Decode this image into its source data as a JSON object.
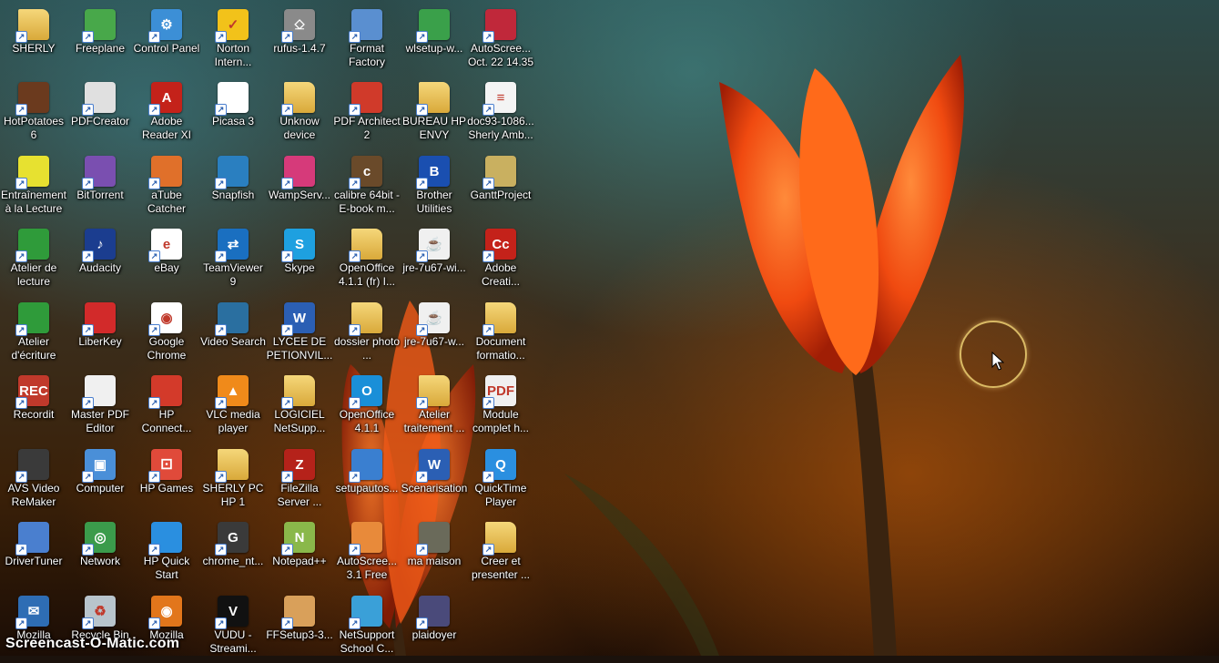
{
  "desktop": {
    "icons": [
      {
        "label": "SHERLY",
        "icon": "folder-icon",
        "color": "#e8c25a"
      },
      {
        "label": "HotPotatoes 6",
        "icon": "hotpotatoes-icon",
        "color": "#6b3a1e"
      },
      {
        "label": "Entraînement à la Lecture",
        "icon": "lecture-icon",
        "color": "#e7e130"
      },
      {
        "label": "Atelier de lecture",
        "icon": "atelier-icon",
        "color": "#2f9b3a"
      },
      {
        "label": "Atelier d'écriture",
        "icon": "atelier-ecriture-icon",
        "color": "#2f9b3a"
      },
      {
        "label": "Recordit",
        "icon": "record-icon",
        "color": "#c0392b"
      },
      {
        "label": "AVS Video ReMaker",
        "icon": "film-icon",
        "color": "#3a3a3a"
      },
      {
        "label": "DriverTuner",
        "icon": "driver-icon",
        "color": "#4a7fcf"
      },
      {
        "label": "Mozilla",
        "icon": "thunderbird-icon",
        "color": "#2e6db4"
      },
      {
        "label": "Freeplane",
        "icon": "freeplane-icon",
        "color": "#48a84a"
      },
      {
        "label": "PDFCreator",
        "icon": "pdf-creator-icon",
        "color": "#e0e0e0"
      },
      {
        "label": "BitTorrent",
        "icon": "bittorrent-icon",
        "color": "#7a4fb0"
      },
      {
        "label": "Audacity",
        "icon": "audacity-icon",
        "color": "#1b3d8f"
      },
      {
        "label": "LiberKey",
        "icon": "liberkey-icon",
        "color": "#d22a2a"
      },
      {
        "label": "Master PDF Editor",
        "icon": "pdf-editor-icon",
        "color": "#f0f0f0"
      },
      {
        "label": "Computer",
        "icon": "computer-icon",
        "color": "#4a8fd8"
      },
      {
        "label": "Network",
        "icon": "network-icon",
        "color": "#3b9b4b"
      },
      {
        "label": "Recycle Bin",
        "icon": "recycle-bin-icon",
        "color": "#b8c4cc"
      },
      {
        "label": "Control Panel",
        "icon": "control-panel-icon",
        "color": "#3c8fd6"
      },
      {
        "label": "Adobe Reader XI",
        "icon": "adobe-reader-icon",
        "color": "#c4221a"
      },
      {
        "label": "aTube Catcher",
        "icon": "atube-icon",
        "color": "#e0702a"
      },
      {
        "label": "eBay",
        "icon": "ebay-icon",
        "color": "#ffffff"
      },
      {
        "label": "Google Chrome",
        "icon": "chrome-icon",
        "color": "#ffffff"
      },
      {
        "label": "HP Connect...",
        "icon": "hp-connect-icon",
        "color": "#d33a2a"
      },
      {
        "label": "HP Games",
        "icon": "hp-games-icon",
        "color": "#e04a3a"
      },
      {
        "label": "HP Quick Start",
        "icon": "hp-quickstart-icon",
        "color": "#2a8fe0"
      },
      {
        "label": "Mozilla",
        "icon": "firefox-icon",
        "color": "#e2761b"
      },
      {
        "label": "Norton Intern...",
        "icon": "norton-icon",
        "color": "#f2c21a"
      },
      {
        "label": "Picasa 3",
        "icon": "picasa-icon",
        "color": "#ffffff"
      },
      {
        "label": "Snapfish",
        "icon": "snapfish-icon",
        "color": "#2a7fc0"
      },
      {
        "label": "TeamViewer 9",
        "icon": "teamviewer-icon",
        "color": "#1a6fc0"
      },
      {
        "label": "Video Search",
        "icon": "video-search-icon",
        "color": "#2a6fa0"
      },
      {
        "label": "VLC media player",
        "icon": "vlc-icon",
        "color": "#f08a1a"
      },
      {
        "label": "SHERLY PC HP 1",
        "icon": "folder-icon",
        "color": "#e8c25a"
      },
      {
        "label": "chrome_nt...",
        "icon": "google-icon",
        "color": "#3a3a3a"
      },
      {
        "label": "VUDU - Streami...",
        "icon": "vudu-icon",
        "color": "#111111"
      },
      {
        "label": "rufus-1.4.7",
        "icon": "usb-icon",
        "color": "#8a8a8a"
      },
      {
        "label": "Unknow device",
        "icon": "folder-icon",
        "color": "#e8c25a"
      },
      {
        "label": "WampServ...",
        "icon": "wamp-icon",
        "color": "#d63a7a"
      },
      {
        "label": "Skype",
        "icon": "skype-icon",
        "color": "#1ea0e0"
      },
      {
        "label": "LYCEE DE PETIONVIL...",
        "icon": "word-icon",
        "color": "#2b5fb4"
      },
      {
        "label": "LOGICIEL NetSupp...",
        "icon": "folder-icon",
        "color": "#e8c25a"
      },
      {
        "label": "FileZilla Server ...",
        "icon": "filezilla-icon",
        "color": "#b5221a"
      },
      {
        "label": "Notepad++",
        "icon": "notepad-icon",
        "color": "#8ab84a"
      },
      {
        "label": "FFSetup3-3...",
        "icon": "setup-icon",
        "color": "#d9a05a"
      },
      {
        "label": "Format Factory",
        "icon": "format-factory-icon",
        "color": "#5a8fd0"
      },
      {
        "label": "PDF Architect 2",
        "icon": "pdf-architect-icon",
        "color": "#d03a2a"
      },
      {
        "label": "calibre 64bit - E-book m...",
        "icon": "calibre-icon",
        "color": "#6a4a2a"
      },
      {
        "label": "OpenOffice 4.1.1 (fr) I...",
        "icon": "folder-icon",
        "color": "#e8c25a"
      },
      {
        "label": "dossier photo ...",
        "icon": "folder-icon",
        "color": "#e8c25a"
      },
      {
        "label": "OpenOffice 4.1.1",
        "icon": "openoffice-icon",
        "color": "#1a8fd8"
      },
      {
        "label": "setupautos...",
        "icon": "installer-icon",
        "color": "#3a7fd0"
      },
      {
        "label": "AutoScree... 3.1 Free",
        "icon": "autoscreen-icon",
        "color": "#e88a3a"
      },
      {
        "label": "NetSupport School C...",
        "icon": "netsupport-icon",
        "color": "#3aa0d8"
      },
      {
        "label": "wlsetup-w...",
        "icon": "wlsetup-icon",
        "color": "#3aa04a"
      },
      {
        "label": "BUREAU HP ENVY",
        "icon": "folder-icon",
        "color": "#e8c25a"
      },
      {
        "label": "Brother Utilities",
        "icon": "brother-icon",
        "color": "#1a4fb0"
      },
      {
        "label": "jre-7u67-wi...",
        "icon": "java-icon",
        "color": "#f0f0f0"
      },
      {
        "label": "jre-7u67-w...",
        "icon": "java-icon",
        "color": "#f0f0f0"
      },
      {
        "label": "Atelier traitement ...",
        "icon": "folder-icon",
        "color": "#e8c25a"
      },
      {
        "label": "Scenarisation",
        "icon": "word-icon",
        "color": "#2b5fb4"
      },
      {
        "label": "ma maison",
        "icon": "image-icon",
        "color": "#6a6a5a"
      },
      {
        "label": "plaidoyer",
        "icon": "video-icon",
        "color": "#4a4a7a"
      },
      {
        "label": "AutoScree... Oct. 22 14.35",
        "icon": "autoscreen-file-icon",
        "color": "#c0283a"
      },
      {
        "label": "doc93-1086... Sherly Amb...",
        "icon": "document-icon",
        "color": "#f4f4f4"
      },
      {
        "label": "GanttProject",
        "icon": "ganttproject-icon",
        "color": "#c9b060"
      },
      {
        "label": "Adobe Creati...",
        "icon": "adobe-creative-icon",
        "color": "#c4221a"
      },
      {
        "label": "Document formatio...",
        "icon": "folder-icon",
        "color": "#e8c25a"
      },
      {
        "label": "Module complet h...",
        "icon": "pdf-icon",
        "color": "#f0f0f0"
      },
      {
        "label": "QuickTime Player",
        "icon": "quicktime-icon",
        "color": "#2a8fe0"
      },
      {
        "label": "Creer et presenter ...",
        "icon": "folder-icon",
        "color": "#e8c25a"
      }
    ]
  },
  "watermark": {
    "text": "Screencast-O-Matic.com"
  }
}
